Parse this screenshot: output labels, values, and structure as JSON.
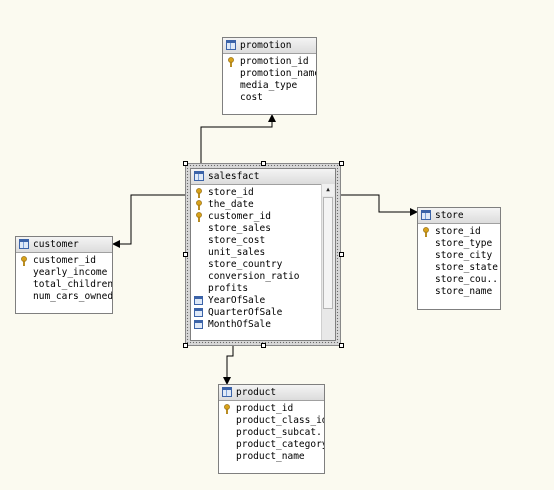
{
  "tables": {
    "promotion": {
      "title": "promotion",
      "columns": [
        "promotion_id",
        "promotion_name",
        "media_type",
        "cost"
      ]
    },
    "salesfact": {
      "title": "salesfact",
      "columns": [
        "store_id",
        "the_date",
        "customer_id",
        "store_sales",
        "store_cost",
        "unit_sales",
        "store_country",
        "conversion_ratio",
        "profits",
        "YearOfSale",
        "QuarterOfSale",
        "MonthOfSale"
      ]
    },
    "customer": {
      "title": "customer",
      "columns": [
        "customer_id",
        "yearly_income",
        "total_children",
        "num_cars_owned"
      ]
    },
    "store": {
      "title": "store",
      "columns": [
        "store_id",
        "store_type",
        "store_city",
        "store_state",
        "store_cou...",
        "store_name"
      ]
    },
    "product": {
      "title": "product",
      "columns": [
        "product_id",
        "product_class_id",
        "product_subcat...",
        "product_category",
        "product_name"
      ]
    }
  },
  "icons": {
    "key": "key-icon",
    "table": "table-icon",
    "column": "column-icon"
  },
  "colors": {
    "background": "#fbfaf0",
    "key": "#d8a21a",
    "table_icon": "#3b63a8"
  }
}
